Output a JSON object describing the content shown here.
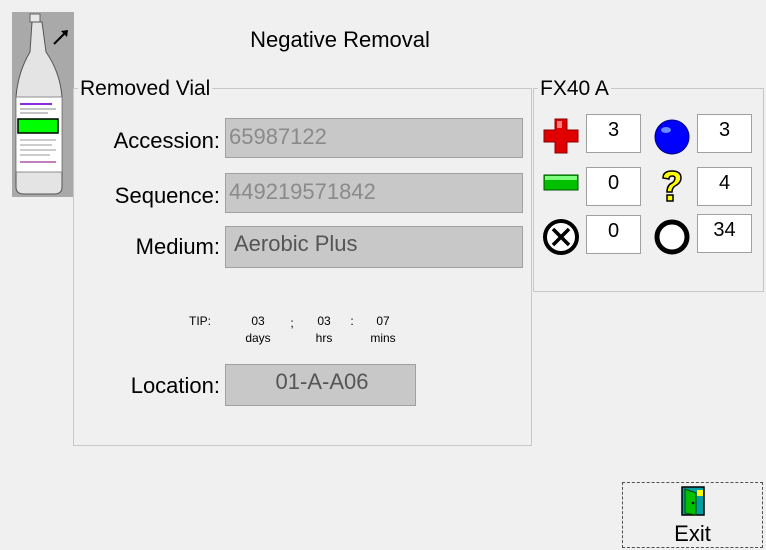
{
  "header": {
    "title": "Negative Removal"
  },
  "removed_vial": {
    "legend": "Removed Vial",
    "accession_label": "Accession:",
    "accession_value": "65987122",
    "sequence_label": "Sequence:",
    "sequence_value": "449219571842",
    "medium_label": "Medium:",
    "medium_value": "Aerobic Plus",
    "tip": {
      "label": "TIP:",
      "days": "03",
      "days_unit": "days",
      "sep1": ";",
      "hrs": "03",
      "hrs_unit": "hrs",
      "sep2": ":",
      "mins": "07",
      "mins_unit": "mins"
    },
    "location_label": "Location:",
    "location_value": "01-A-A06"
  },
  "instrument": {
    "legend": "FX40 A",
    "positive_count": "3",
    "blue_count": "3",
    "green_count": "0",
    "question_count": "4",
    "error_count": "0",
    "empty_count": "34"
  },
  "footer": {
    "exit_label": "Exit"
  },
  "colors": {
    "positive": "#e00000",
    "blue": "#0000ff",
    "green": "#00c000",
    "question": "#ffff00",
    "field_bg": "#c8c8c8"
  },
  "icons": {
    "vial": "vial-icon",
    "positive": "red-cross-icon",
    "blue": "blue-circle-icon",
    "green": "green-bar-icon",
    "question": "question-mark-icon",
    "error": "circled-x-icon",
    "empty": "empty-circle-icon",
    "exit": "exit-door-icon",
    "arrow": "expand-arrow-icon"
  }
}
